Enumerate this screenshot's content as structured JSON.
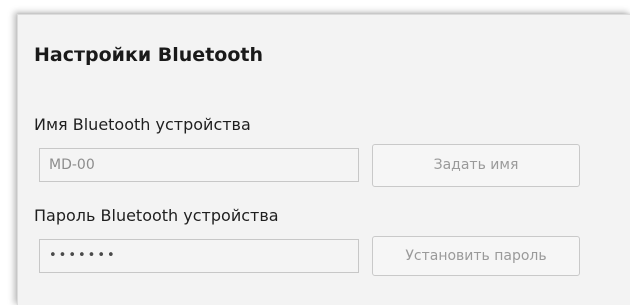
{
  "settings": {
    "title": "Настройки Bluetooth",
    "device_name": {
      "label": "Имя Bluetooth устройства",
      "value": "MD-00",
      "button_label": "Задать имя"
    },
    "device_password": {
      "label": "Пароль Bluetooth устройства",
      "value_masked": "•••••••",
      "button_label": "Установить пароль"
    }
  }
}
